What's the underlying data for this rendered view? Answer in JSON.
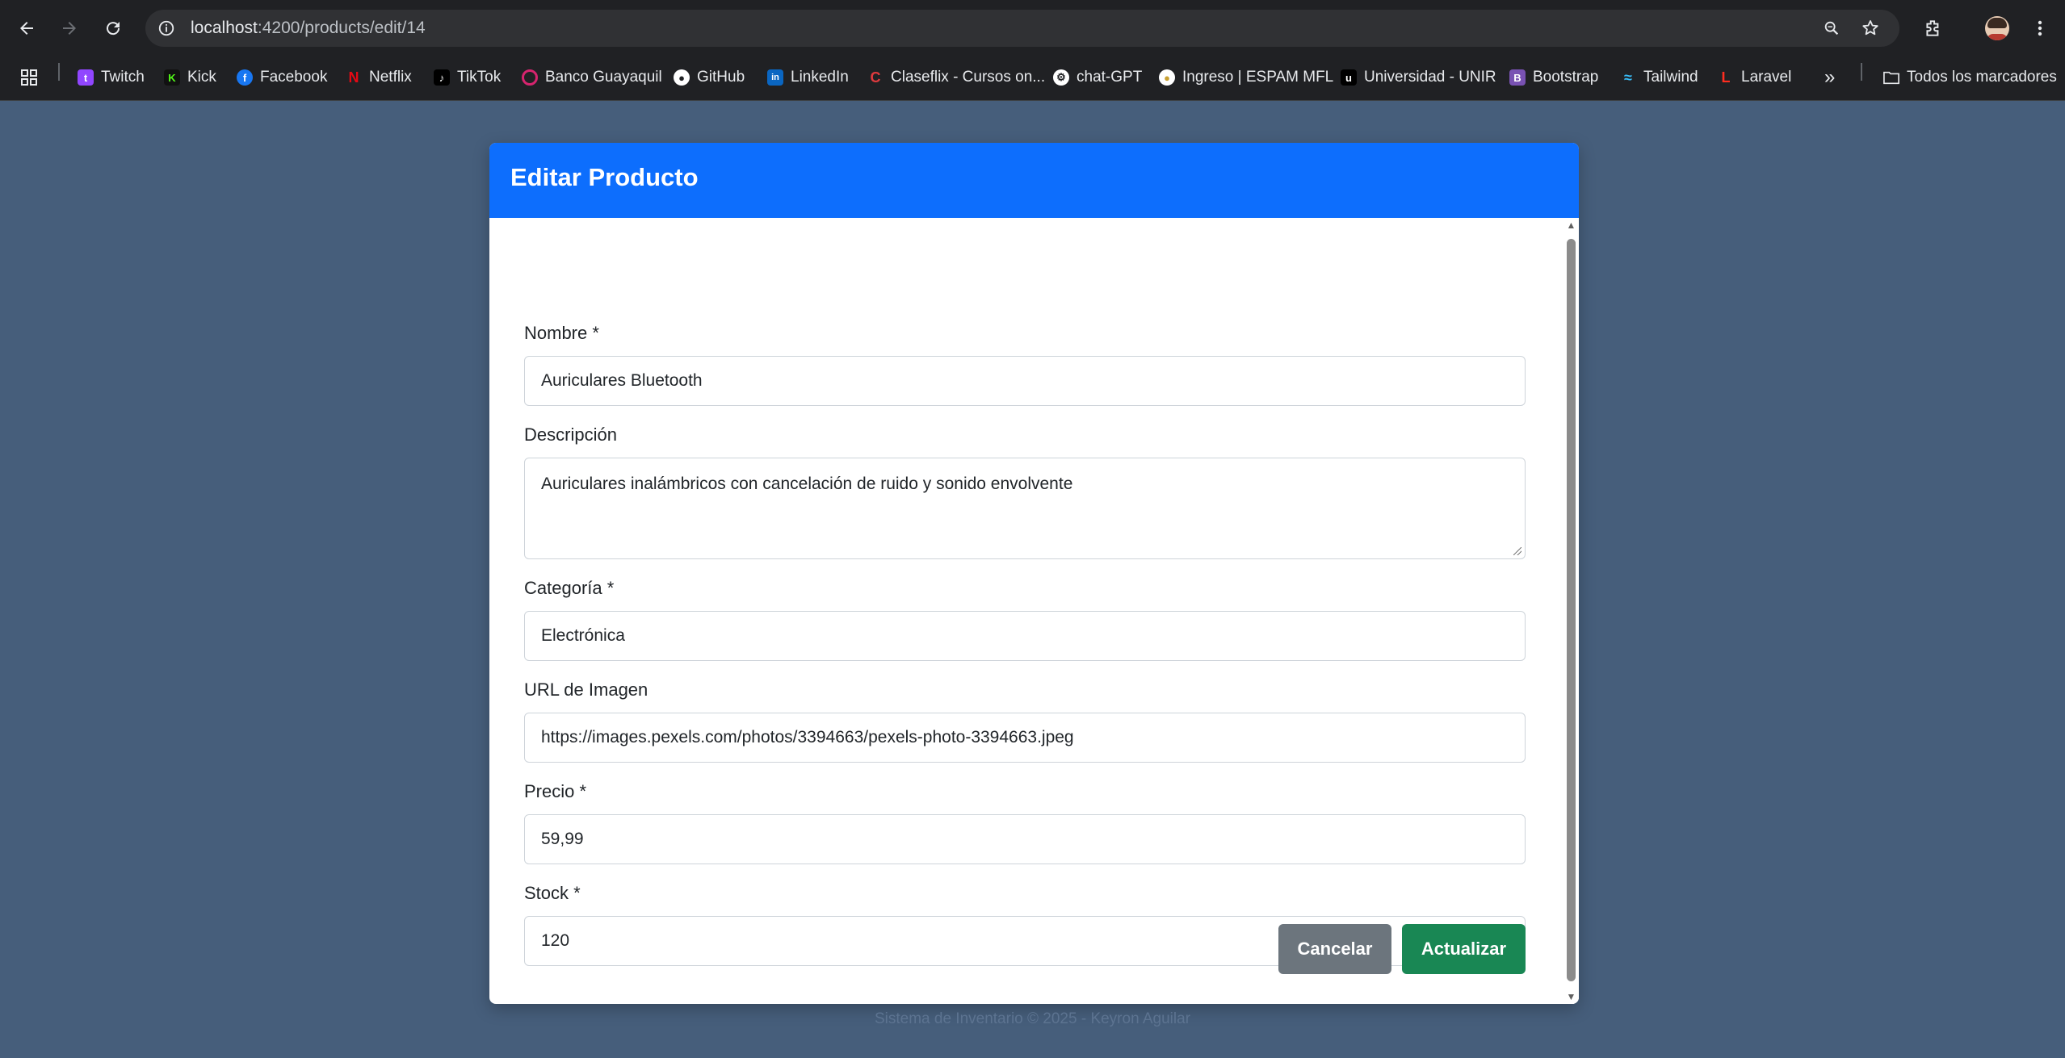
{
  "browser": {
    "url_host": "localhost",
    "url_path": ":4200/products/edit/14",
    "bookmarks": [
      {
        "label": "Twitch",
        "color": "#9146ff",
        "glyph": "t"
      },
      {
        "label": "Kick",
        "color": "#53fc18",
        "glyph": "K"
      },
      {
        "label": "Facebook",
        "color": "#1877f2",
        "glyph": "f"
      },
      {
        "label": "Netflix",
        "color": "#e50914",
        "glyph": "N"
      },
      {
        "label": "TikTok",
        "color": "#111111",
        "glyph": "♪"
      },
      {
        "label": "Banco Guayaquil",
        "color": "#d6246e",
        "glyph": "○"
      },
      {
        "label": "GitHub",
        "color": "#ffffff",
        "glyph": "●"
      },
      {
        "label": "LinkedIn",
        "color": "#0a66c2",
        "glyph": "in"
      },
      {
        "label": "Claseflix - Cursos on...",
        "color": "#e03a3e",
        "glyph": "C"
      },
      {
        "label": "chat-GPT",
        "color": "#ffffff",
        "glyph": "⚙"
      },
      {
        "label": "Ingreso | ESPAM MFL",
        "color": "#ffffff",
        "glyph": "●"
      },
      {
        "label": "Universidad - UNIR",
        "color": "#000000",
        "glyph": "u"
      },
      {
        "label": "Bootstrap",
        "color": "#7952b3",
        "glyph": "B"
      },
      {
        "label": "Tailwind",
        "color": "#38bdf8",
        "glyph": "≈"
      },
      {
        "label": "Laravel",
        "color": "#ff2d20",
        "glyph": "L"
      }
    ],
    "more_label": "»",
    "all_bookmarks": "Todos los marcadores"
  },
  "form": {
    "title": "Editar Producto",
    "fields": {
      "nombre": {
        "label": "Nombre *",
        "value": "Auriculares Bluetooth"
      },
      "descripcion": {
        "label": "Descripción",
        "value": "Auriculares inalámbricos con cancelación de ruido y sonido envolvente"
      },
      "categoria": {
        "label": "Categoría *",
        "value": "Electrónica"
      },
      "imagen": {
        "label": "URL de Imagen",
        "value": "https://images.pexels.com/photos/3394663/pexels-photo-3394663.jpeg"
      },
      "precio": {
        "label": "Precio *",
        "value": "59,99"
      },
      "stock": {
        "label": "Stock *",
        "value": "120"
      }
    },
    "cancel_label": "Cancelar",
    "update_label": "Actualizar"
  },
  "footer": "Sistema de Inventario © 2025 - Keyron Aguilar"
}
